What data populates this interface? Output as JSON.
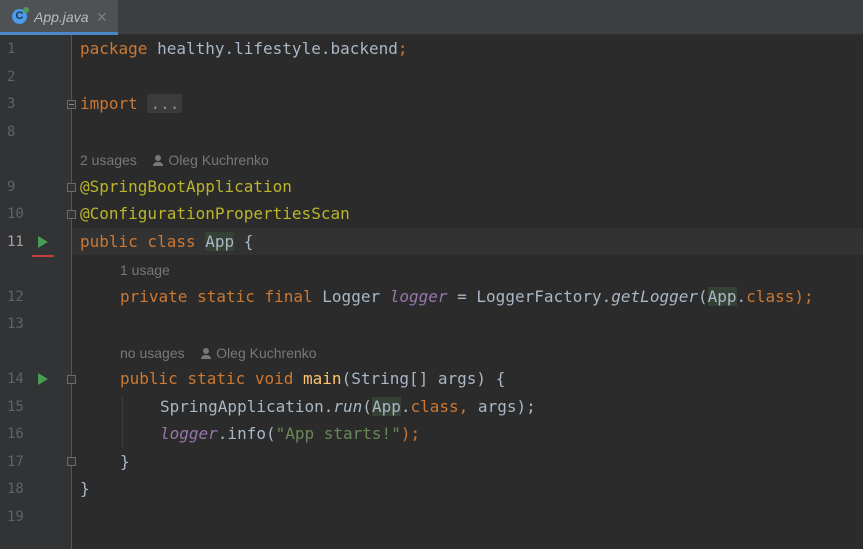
{
  "tabs": [
    {
      "title": "App.java",
      "icon": "java-class-icon",
      "active": true
    }
  ],
  "gutter": {
    "line_numbers": [
      "1",
      "2",
      "3",
      "8",
      "9",
      "10",
      "11",
      "12",
      "13",
      "14",
      "15",
      "16",
      "17",
      "18",
      "19"
    ],
    "active_line": "11"
  },
  "code": {
    "line1": {
      "kw": "package",
      "rest": " healthy.lifestyle.backend",
      "semi": ";"
    },
    "line3": {
      "kw": "import",
      "folded": "..."
    },
    "hint_class": {
      "usages": "2 usages",
      "author": "Oleg Kuchrenko"
    },
    "line9": "@SpringBootApplication",
    "line10": "@ConfigurationPropertiesScan",
    "line11": {
      "kw": "public class",
      "name": "App",
      "rest": " {"
    },
    "hint_logger": {
      "usages": "1 usage"
    },
    "line12": {
      "kw": "private static final",
      "type": " Logger ",
      "field": "logger",
      "eq": " = LoggerFactory.",
      "method": "getLogger",
      "open": "(",
      "cls": "App",
      "dot": ".",
      "classkw": "class",
      "close": ");"
    },
    "hint_main": {
      "usages": "no usages",
      "author": "Oleg Kuchrenko"
    },
    "line14": {
      "kw": "public static void",
      "name": "main",
      "rest": "(String[] args) {"
    },
    "line15": {
      "prefix": "SpringApplication.",
      "method": "run",
      "open": "(",
      "cls": "App",
      "dot": ".",
      "classkw": "class",
      "comma": ",",
      "rest": " args);"
    },
    "line16": {
      "field": "logger",
      "call": ".info(",
      "str": "\"App starts!\"",
      "close": ");"
    },
    "line17": "}",
    "line18": "}"
  }
}
